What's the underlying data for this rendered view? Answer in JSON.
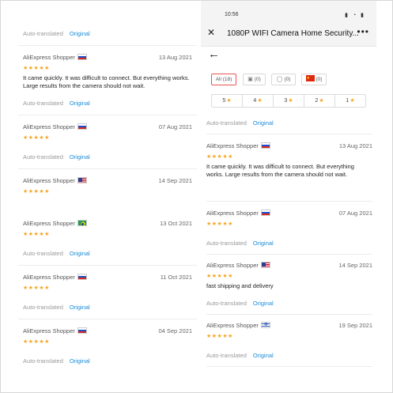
{
  "left": {
    "top_auto": {
      "auto": "Auto-translated",
      "original": "Original"
    },
    "reviews": [
      {
        "name": "AliExpress Shopper",
        "flag": "ru",
        "date": "13 Aug 2021",
        "stars": "★★★★★",
        "text": "It came quickly. It was difficult to connect. But everything works. Large results from the camera should not wait.",
        "auto": "Auto-translated",
        "original": "Original"
      },
      {
        "name": "AliExpress Shopper",
        "flag": "ru",
        "date": "07 Aug 2021",
        "stars": "★★★★★",
        "text": "",
        "auto": "Auto-translated",
        "original": "Original"
      },
      {
        "name": "AliExpress Shopper",
        "flag": "us",
        "date": "14 Sep 2021",
        "stars": "★★★★★",
        "text": "",
        "auto": "",
        "original": ""
      },
      {
        "name": "AliExpress Shopper",
        "flag": "br",
        "date": "13 Oct 2021",
        "stars": "★★★★★",
        "text": "",
        "auto": "Auto-translated",
        "original": "Original"
      },
      {
        "name": "AliExpress Shopper",
        "flag": "ru",
        "date": "11 Oct 2021",
        "stars": "★★★★★",
        "text": "",
        "auto": "Auto-translated",
        "original": "Original"
      },
      {
        "name": "AliExpress Shopper",
        "flag": "ru",
        "date": "04 Sep 2021",
        "stars": "★★★★★",
        "text": "",
        "auto": "Auto-translated",
        "original": "Original"
      }
    ]
  },
  "right": {
    "status": {
      "time": "10:56",
      "icons": "▮ ◔ ▮"
    },
    "topbar": {
      "close": "✕",
      "title": "1080P WIFI Camera Home Security...",
      "more": "•••"
    },
    "back": "←",
    "filters": {
      "all": "All (18)",
      "photo_count": "(0)",
      "comment_count": "(0)",
      "local_count": "(0)"
    },
    "star_filters": [
      {
        "label": "5",
        "star": "★"
      },
      {
        "label": "4",
        "star": "★"
      },
      {
        "label": "3",
        "star": "★"
      },
      {
        "label": "2",
        "star": "★"
      },
      {
        "label": "1",
        "star": "★"
      }
    ],
    "top_auto": {
      "auto": "Auto-translated",
      "original": "Original"
    },
    "reviews": [
      {
        "name": "AliExpress Shopper",
        "flag": "ru",
        "date": "13 Aug 2021",
        "stars": "★★★★★",
        "text": "It came quickly. It was difficult to connect. But everything works. Large results from the camera should not wait.",
        "auto": "",
        "original": ""
      },
      {
        "name": "AliExpress Shopper",
        "flag": "ru",
        "date": "07 Aug 2021",
        "stars": "★★★★★",
        "text": "",
        "auto": "Auto-translated",
        "original": "Original"
      },
      {
        "name": "AliExpress Shopper",
        "flag": "us",
        "date": "14 Sep 2021",
        "stars": "★★★★★",
        "text": "fast shipping and delivery",
        "auto": "Auto-translated",
        "original": "Original"
      },
      {
        "name": "AliExpress Shopper",
        "flag": "il",
        "date": "19 Sep 2021",
        "stars": "★★★★★",
        "text": "",
        "auto": "Auto-translated",
        "original": "Original"
      }
    ]
  },
  "colors": {
    "star": "#f5a623",
    "link": "#1a8bd6",
    "active_chip": "#e8554e"
  }
}
